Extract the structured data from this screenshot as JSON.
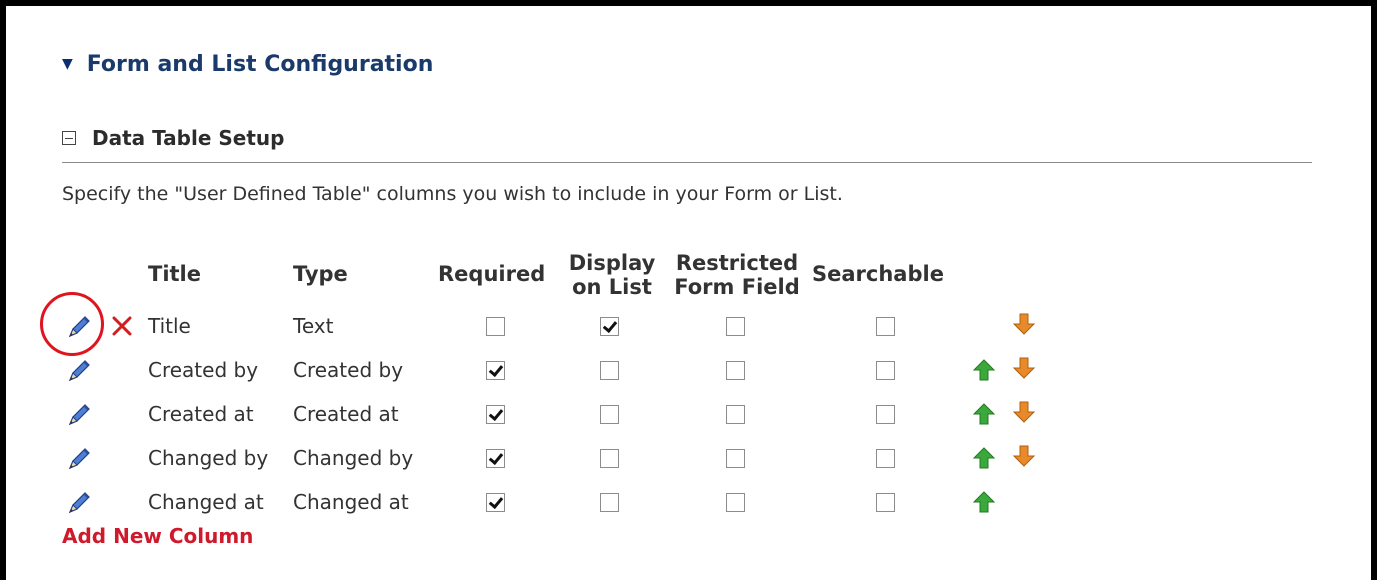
{
  "section": {
    "title": "Form and List Configuration",
    "toggle_icon": "triangle-down-icon"
  },
  "subsection": {
    "title": "Data Table Setup",
    "toggle_icon": "collapse-minus-icon"
  },
  "description": "Specify the \"User Defined Table\" columns you wish to include in your Form or List.",
  "columns": {
    "title": "Title",
    "type": "Type",
    "required": "Required",
    "display_line1": "Display",
    "display_line2": "on List",
    "restricted_line1": "Restricted",
    "restricted_line2": "Form Field",
    "searchable": "Searchable"
  },
  "rows": [
    {
      "title": "Title",
      "type": "Text",
      "required": false,
      "display": true,
      "restricted": false,
      "searchable": false,
      "deletable": true,
      "up": false,
      "down": true
    },
    {
      "title": "Created by",
      "type": "Created by",
      "required": true,
      "display": false,
      "restricted": false,
      "searchable": false,
      "deletable": false,
      "up": true,
      "down": true
    },
    {
      "title": "Created at",
      "type": "Created at",
      "required": true,
      "display": false,
      "restricted": false,
      "searchable": false,
      "deletable": false,
      "up": true,
      "down": true
    },
    {
      "title": "Changed by",
      "type": "Changed by",
      "required": true,
      "display": false,
      "restricted": false,
      "searchable": false,
      "deletable": false,
      "up": true,
      "down": true
    },
    {
      "title": "Changed at",
      "type": "Changed at",
      "required": true,
      "display": false,
      "restricted": false,
      "searchable": false,
      "deletable": false,
      "up": true,
      "down": false
    }
  ],
  "add_column_label": "Add New Column",
  "colors": {
    "accent_blue": "#1a3a6b",
    "link_red": "#d0192b",
    "highlight_red": "#e0141e",
    "arrow_green": "#3aa83a",
    "arrow_orange": "#e8892a"
  }
}
